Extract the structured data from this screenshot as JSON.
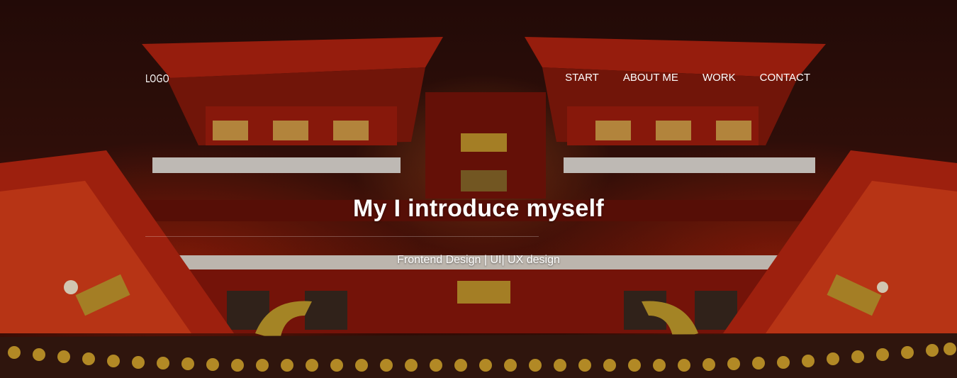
{
  "header": {
    "logo_text": "LOGO",
    "nav": [
      {
        "label": "START"
      },
      {
        "label": "ABOUT ME"
      },
      {
        "label": "WORK"
      },
      {
        "label": "CONTACT"
      }
    ]
  },
  "hero": {
    "title": "My I introduce myself",
    "subtitle": "Frontend Design | UI| UX design",
    "background_image": "temple-night-photo"
  },
  "colors": {
    "text": "#ffffff",
    "accent": "#c81e0a"
  }
}
